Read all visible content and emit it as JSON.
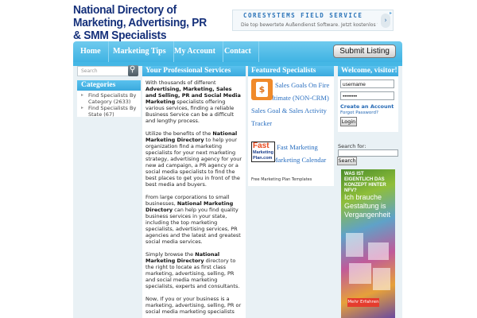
{
  "header": {
    "site_title": "National Directory of Marketing, Advertising, PR & SMM Specialists",
    "ad": {
      "title": "CORESYSTEMS FIELD SERVICE",
      "subtitle": "Die top bewertete Außendienst Software. Jetzt kostenlos t...",
      "button": "›"
    }
  },
  "nav": {
    "items": [
      "Home",
      "Marketing Tips",
      "My Account",
      "Contact"
    ],
    "submit_label": "Submit Listing"
  },
  "left": {
    "search_placeholder": "Search",
    "categories_title": "Categories",
    "categories": [
      "Find Specialists By Category (2633)",
      "Find Specialists By State (67)"
    ]
  },
  "center": {
    "title": "Your Professional Services",
    "paragraphs": [
      {
        "pre": "With thousands of different ",
        "bold": "Advertising, Marketing, Sales and Selling, PR and Social Media Marketing",
        "post": " specialists offering various services, finding a reliable Business Service can be a difficult and lengthy process."
      },
      {
        "pre": "Utilize the benefits of the ",
        "bold": "National Marketing Directory",
        "post": " to help your organization find a marketing specialists for your next marketing strategy, advertising agency for your new ad campaign, a PR agency or a social media specialists to find the best places to get you in front of the best media and buyers."
      },
      {
        "pre": "From large corporations to small businesses, ",
        "bold": "National Marketing Directory",
        "post": " can help you find quality business services in your state, including the top marketing specialists, advertising services, PR agencies and the latest and greatest social media services."
      },
      {
        "pre": "Simply browse the ",
        "bold": "National Marketing Directory",
        "post": " directory to the right to locate as first class marketing, advertising, selling, PR and social media marketing specialists, experts and consultants."
      },
      {
        "pre": "Now, If you or your business is a marketing, advertising, selling, PR or social media marketing specialists",
        "bold": "",
        "post": ""
      }
    ]
  },
  "featured": {
    "title": "Featured Specialists",
    "item1_text": "Sales Goals On Fire - The Ultimate (NON-CRM) Sales Goal & Sales Activity Tracker",
    "item1_icon": "$",
    "item2_text": "Fast Marketing Plan & Marketing Calendar",
    "item2_logo": [
      "Fast",
      "Marketing",
      "Plan.com"
    ],
    "sub": "Free Marketing Plan Templates"
  },
  "right": {
    "welcome_title": "Welcome, visitor!",
    "username_value": "username",
    "password_value": "••••••••",
    "create_account": "Create an Account",
    "forgot_password": "Forgot Password?",
    "login_label": "Login",
    "search_for_label": "Search for:",
    "search_button": "Search",
    "ad": {
      "headline": "WAS IST EIGENTLICH DAS KONZEPT HINTER NFV?",
      "tagline": "Ich brauche Gestaltung is Vergangenheit",
      "more_label": "Mehr Erfahren"
    }
  },
  "colors": {
    "nav_blue": "#3fb3e3",
    "title_navy": "#15307a",
    "link_blue": "#2a6fc0",
    "panel_bg": "#e9f1f5"
  }
}
